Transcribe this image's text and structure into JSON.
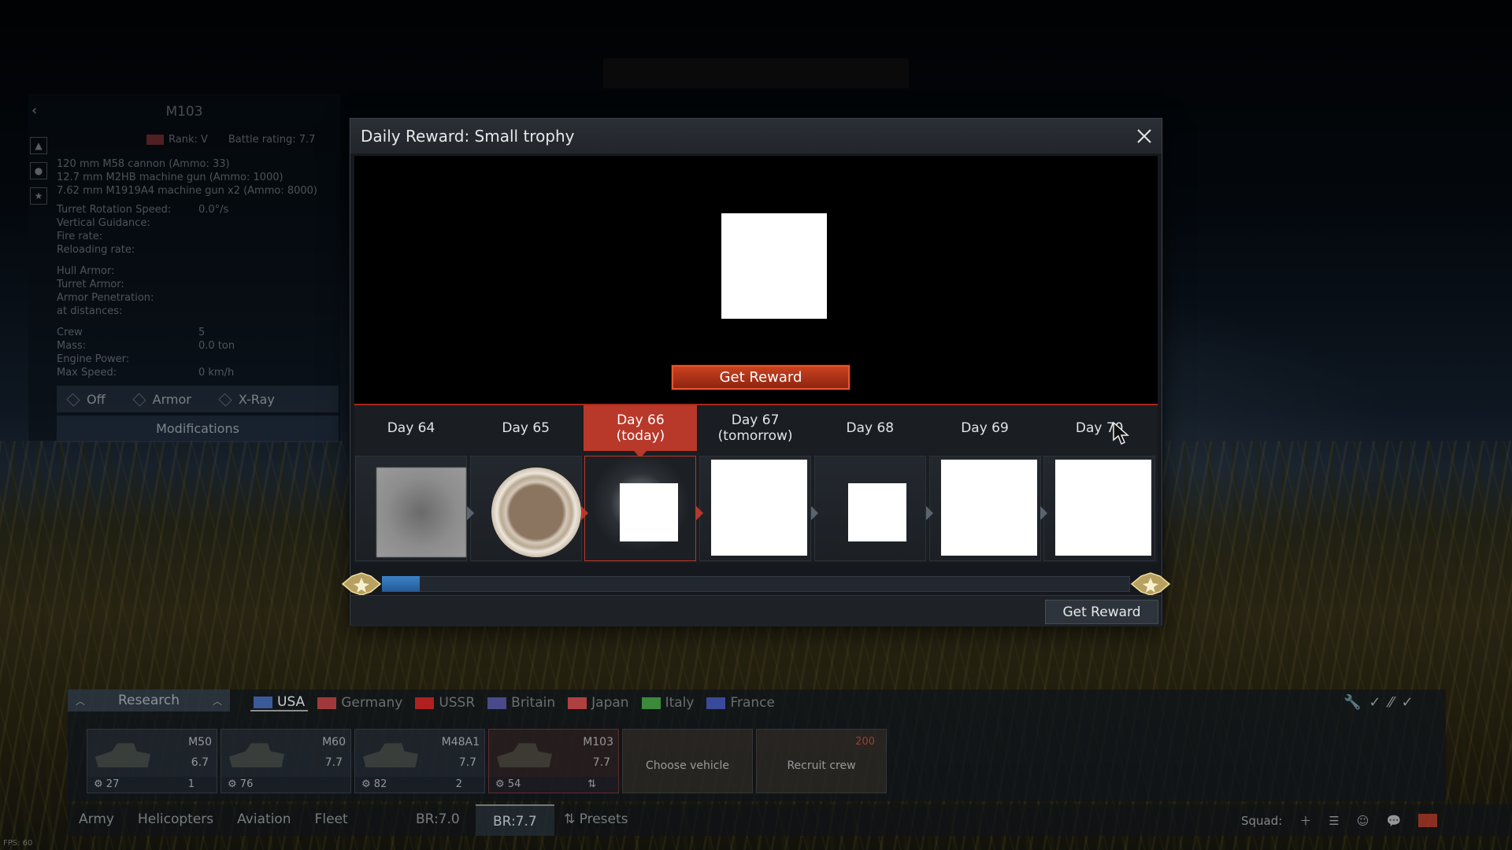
{
  "modal": {
    "title": "Daily Reward: Small trophy",
    "preview_button": "Get Reward",
    "footer_button": "Get Reward",
    "progress_fraction": 0.05,
    "days": [
      {
        "label": "Day 64",
        "state": "past",
        "reward": "blurred"
      },
      {
        "label": "Day 65",
        "state": "past",
        "reward": "coin"
      },
      {
        "label": "Day 66\n(today)",
        "state": "today",
        "reward": "trophy"
      },
      {
        "label": "Day 67\n(tomorrow)",
        "state": "future",
        "reward": "large"
      },
      {
        "label": "Day 68",
        "state": "future",
        "reward": "small"
      },
      {
        "label": "Day 69",
        "state": "future",
        "reward": "large"
      },
      {
        "label": "Day 70",
        "state": "future",
        "reward": "large"
      }
    ]
  },
  "vehicle": {
    "name": "M103",
    "rank": "Rank: V",
    "battle_rating": "Battle rating: 7.7",
    "weapons": [
      "120 mm M58 cannon (Ammo: 33)",
      "12.7 mm M2HB machine gun (Ammo: 1000)",
      "7.62 mm M1919A4 machine gun x2 (Ammo: 8000)"
    ],
    "stats": [
      {
        "k": "Turret Rotation Speed:",
        "v": "0.0°/s"
      },
      {
        "k": "Vertical Guidance:",
        "v": ""
      },
      {
        "k": "Fire rate:",
        "v": ""
      },
      {
        "k": "Reloading rate:",
        "v": ""
      },
      {
        "k": "",
        "v": ""
      },
      {
        "k": "Hull Armor:",
        "v": ""
      },
      {
        "k": "Turret Armor:",
        "v": ""
      },
      {
        "k": "Armor Penetration:",
        "v": ""
      },
      {
        "k": "at distances:",
        "v": ""
      },
      {
        "k": "",
        "v": ""
      },
      {
        "k": "Crew",
        "v": "5"
      },
      {
        "k": "Mass:",
        "v": "0.0 ton"
      },
      {
        "k": "Engine Power:",
        "v": ""
      },
      {
        "k": "Max Speed:",
        "v": "0 km/h"
      }
    ],
    "modes": [
      "Off",
      "Armor",
      "X-Ray"
    ],
    "modifications": "Modifications"
  },
  "research": {
    "toggle_label": "Research",
    "nations": [
      {
        "name": "USA",
        "active": true,
        "color": "#3a5a9a"
      },
      {
        "name": "Germany",
        "active": false,
        "color": "#a03a3a"
      },
      {
        "name": "USSR",
        "active": false,
        "color": "#b02020"
      },
      {
        "name": "Britain",
        "active": false,
        "color": "#4a4a8a"
      },
      {
        "name": "Japan",
        "active": false,
        "color": "#b04040"
      },
      {
        "name": "Italy",
        "active": false,
        "color": "#3a8a3a"
      },
      {
        "name": "France",
        "active": false,
        "color": "#3a4a9a"
      }
    ],
    "slots": [
      {
        "name": "M50",
        "br": "6.7",
        "crew": "27",
        "extra": "1"
      },
      {
        "name": "M60",
        "br": "7.7",
        "crew": "76",
        "extra": ""
      },
      {
        "name": "M48A1",
        "br": "7.7",
        "crew": "82",
        "extra": "2"
      },
      {
        "name": "M103",
        "br": "7.7",
        "crew": "54",
        "extra": "⇅"
      }
    ],
    "choose_vehicle": "Choose vehicle",
    "recruit_crew": "Recruit crew",
    "recruit_price": "200"
  },
  "nav": {
    "items": [
      "Army",
      "Helicopters",
      "Aviation",
      "Fleet"
    ],
    "br1": "BR:7.0",
    "br2": "BR:7.7",
    "presets": "Presets",
    "squad": "Squad:"
  },
  "fps": "FPS: 60"
}
